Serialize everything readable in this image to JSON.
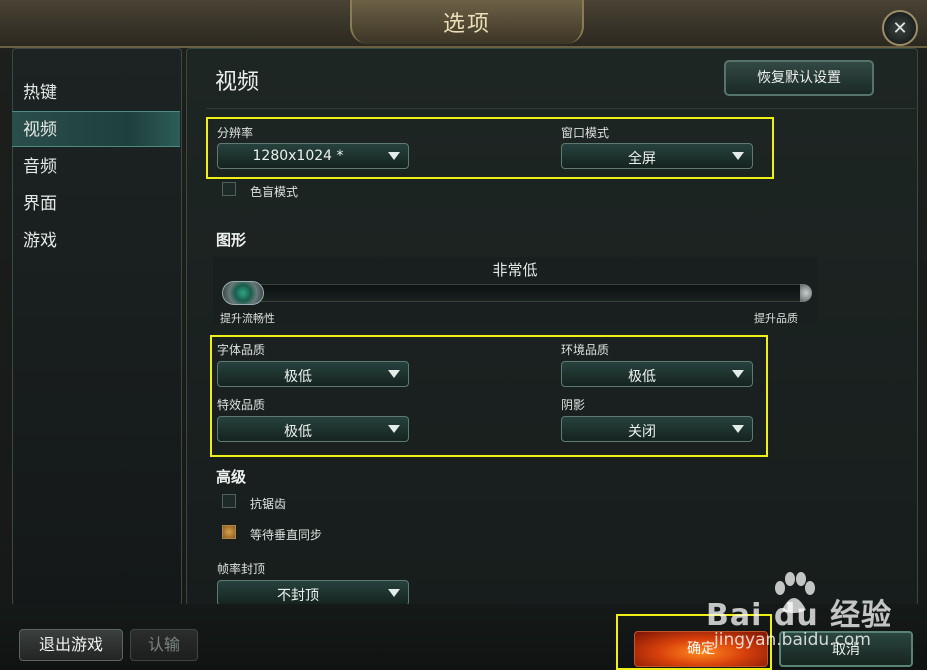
{
  "window": {
    "title": "选项",
    "close_icon": "close-icon"
  },
  "sidebar": {
    "items": [
      {
        "label": "热键"
      },
      {
        "label": "视频",
        "active": true
      },
      {
        "label": "音频"
      },
      {
        "label": "界面"
      },
      {
        "label": "游戏"
      }
    ]
  },
  "main": {
    "title": "视频",
    "restore_defaults": "恢复默认设置",
    "resolution": {
      "label": "分辨率",
      "value": "1280x1024 *"
    },
    "window_mode": {
      "label": "窗口模式",
      "value": "全屏"
    },
    "colorblind": {
      "label": "色盲模式",
      "checked": false
    },
    "graphics": {
      "heading": "图形",
      "level": "非常低",
      "slider_level_fraction": 0,
      "left_label": "提升流畅性",
      "right_label": "提升品质"
    },
    "character_quality": {
      "label": "字体品质",
      "value": "极低"
    },
    "environment_quality": {
      "label": "环境品质",
      "value": "极低"
    },
    "effects_quality": {
      "label": "特效品质",
      "value": "极低"
    },
    "shadows": {
      "label": "阴影",
      "value": "关闭"
    },
    "advanced": {
      "heading": "高级",
      "antialiasing": {
        "label": "抗锯齿",
        "checked": false
      },
      "vsync": {
        "label": "等待垂直同步",
        "checked": true
      },
      "frame_cap": {
        "label": "帧率封顶",
        "value": "不封顶"
      }
    }
  },
  "footer": {
    "quit": "退出游戏",
    "surrender": "认输",
    "ok": "确定",
    "cancel": "取消"
  },
  "watermark": {
    "brand": "Bai du 经验",
    "url": "jingyan.baidu.com"
  },
  "colors": {
    "highlight": "#f0f016",
    "accent": "#5d7b72",
    "ok_button": "#d9420b"
  }
}
